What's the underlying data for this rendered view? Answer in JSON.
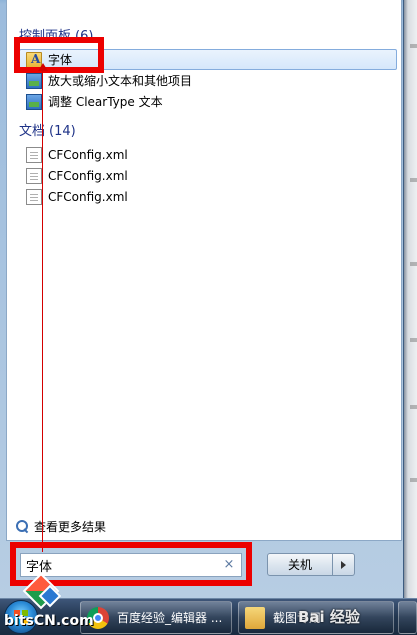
{
  "start_menu": {
    "groups": [
      {
        "header": "控制面板",
        "count": "(6)",
        "items": [
          {
            "label": "字体",
            "icon": "font-folder-icon",
            "selected": true
          },
          {
            "label": "放大或缩小文本和其他项目",
            "icon": "display-settings-icon",
            "selected": false
          },
          {
            "label": "调整 ClearType 文本",
            "icon": "display-settings-icon",
            "selected": false
          }
        ]
      },
      {
        "header": "文档",
        "count": "(14)",
        "items": [
          {
            "label": "CFConfig.xml",
            "icon": "document-icon"
          },
          {
            "label": "CFConfig.xml",
            "icon": "document-icon"
          },
          {
            "label": "CFConfig.xml",
            "icon": "document-icon"
          }
        ]
      }
    ],
    "see_more": "查看更多结果",
    "search": {
      "value": "字体",
      "clear": "×"
    },
    "shutdown_label": "关机"
  },
  "taskbar": {
    "buttons": [
      {
        "label": "百度经验_编辑器 ...",
        "icon": "chrome-icon"
      },
      {
        "label": "截图专用",
        "icon": "folder-icon"
      }
    ]
  },
  "overlays": {
    "logo_text": "bitsCN.com",
    "watermark": "Bai 经验"
  },
  "colors": {
    "highlight": "#ec0000",
    "group_header": "#1e3287",
    "selection": "#d5e7fb"
  }
}
